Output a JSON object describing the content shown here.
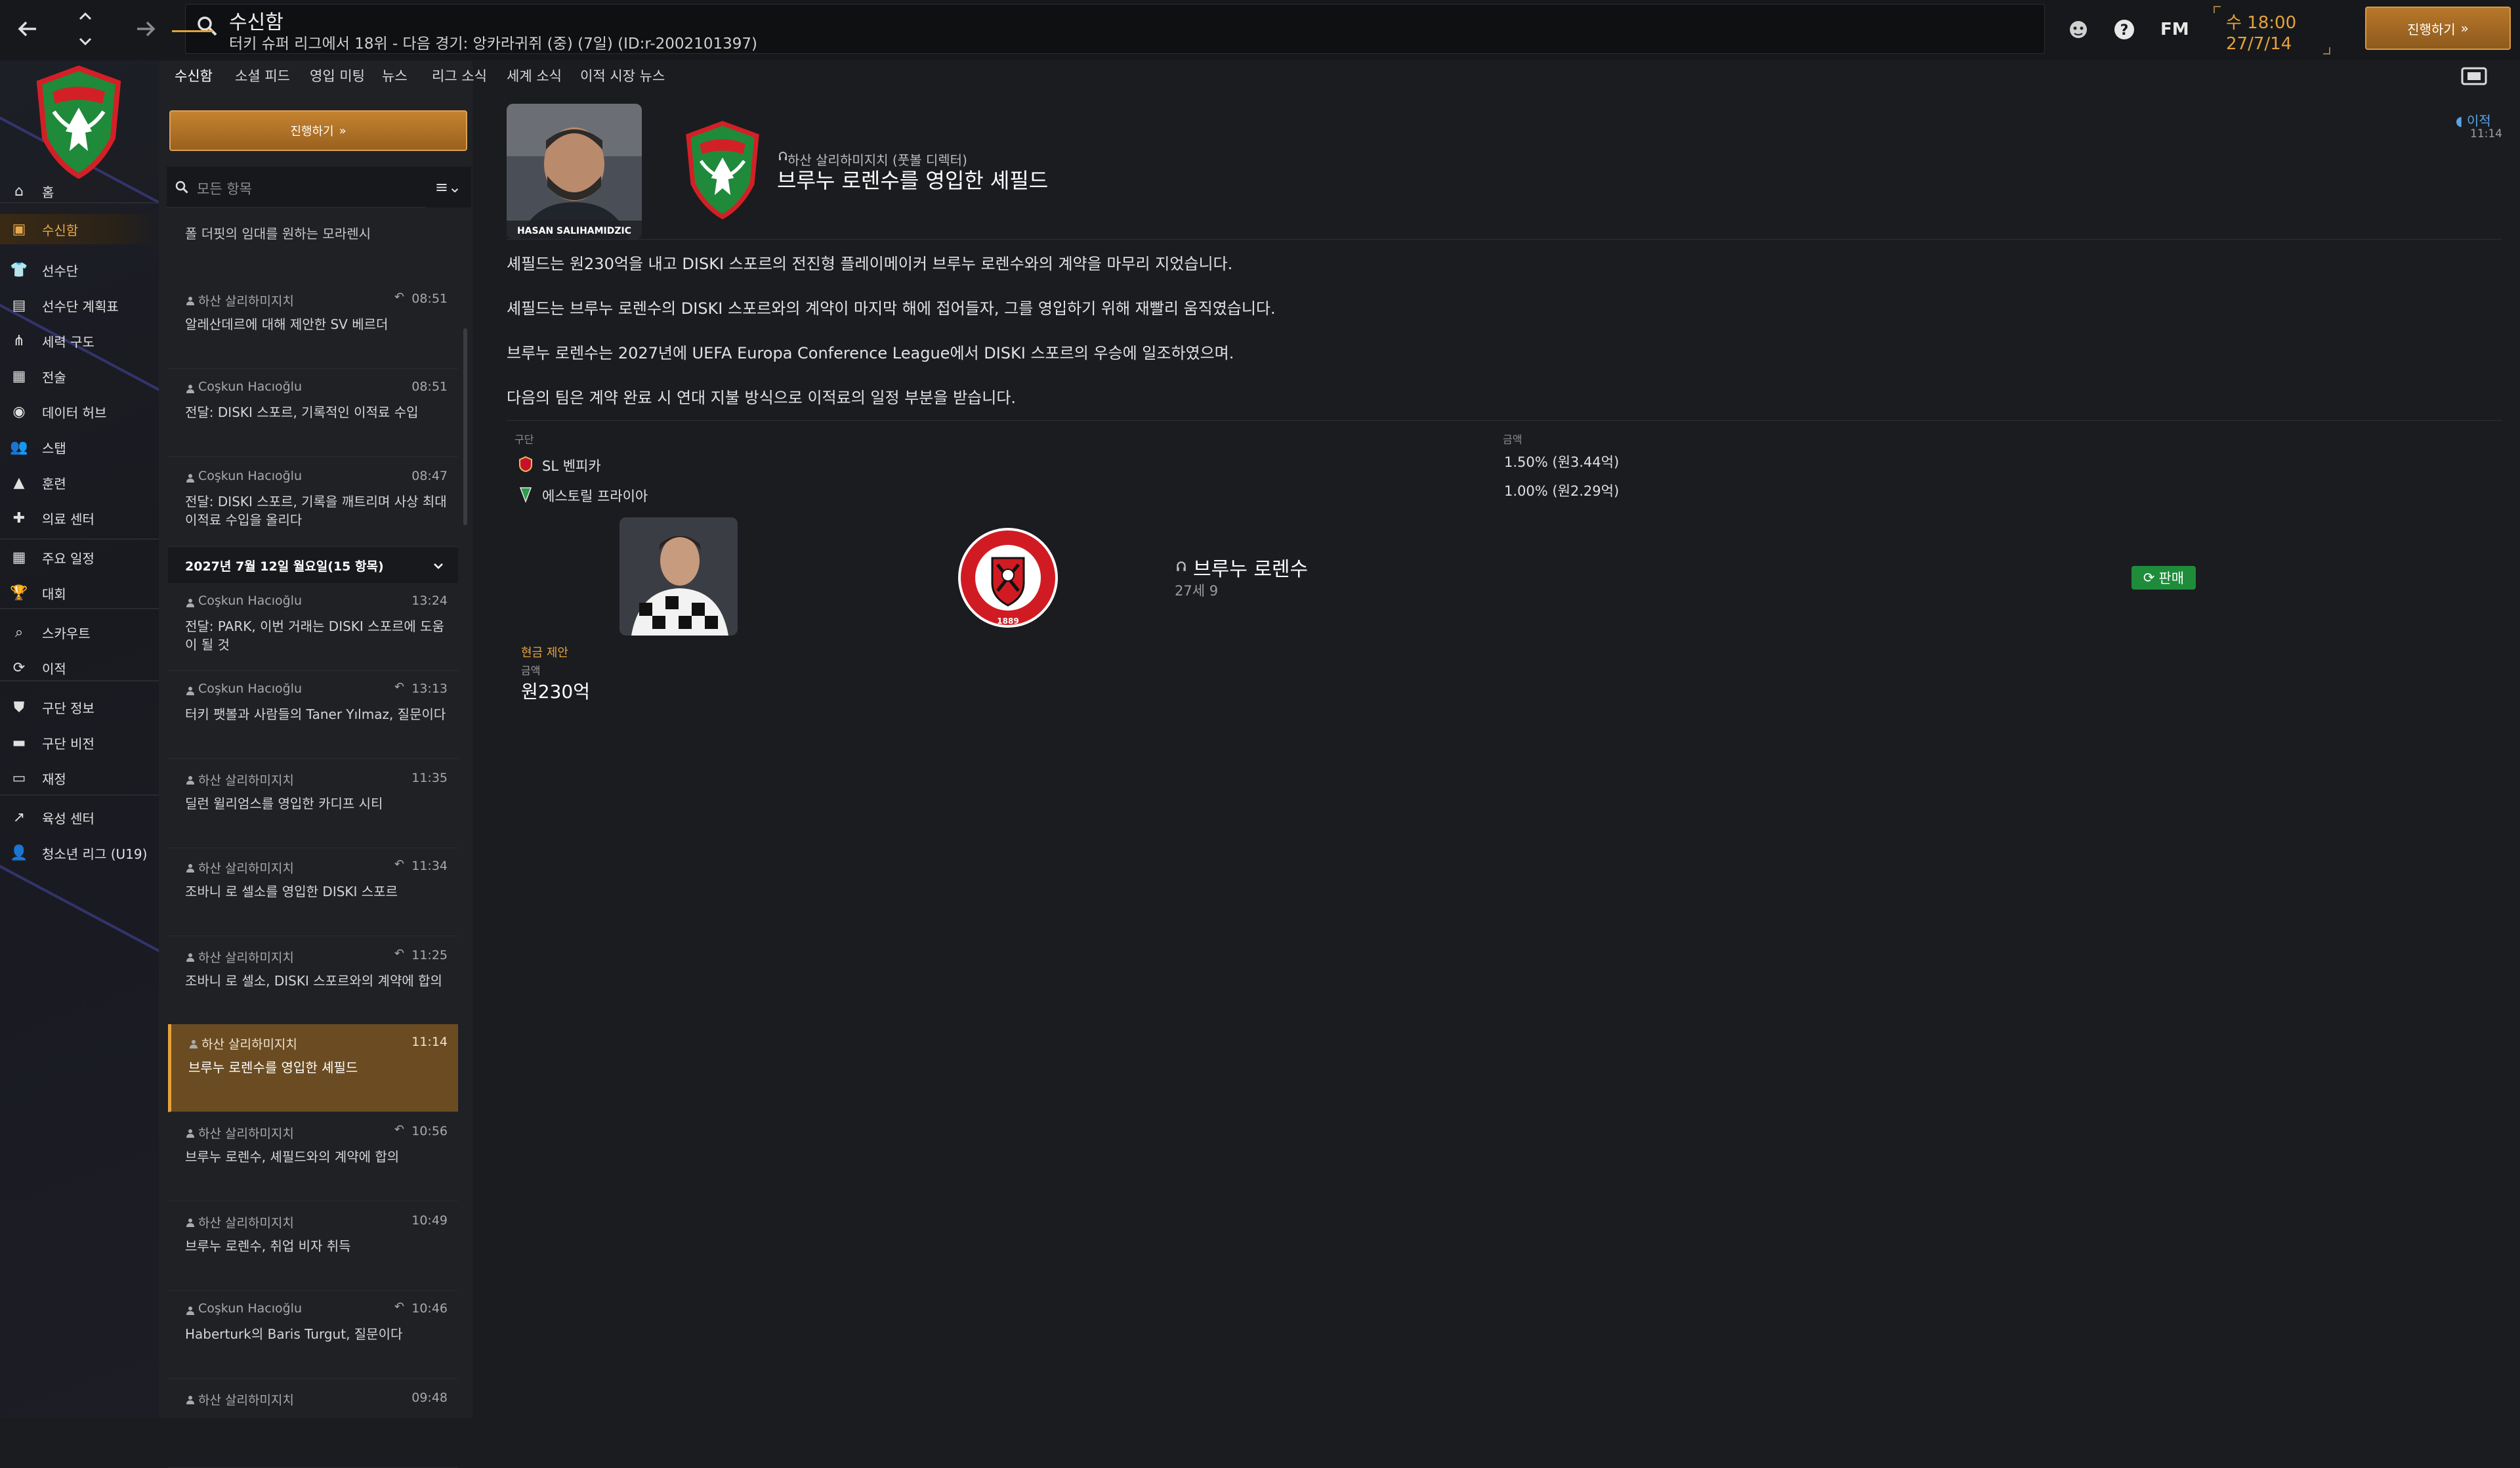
{
  "topbar": {
    "title": "수신함",
    "subtitle": "터키 슈퍼 리그에서 18위 - 다음 경기: 앙카라귀쥐 (중) (7일) (ID:r-2002101397)",
    "fm_logo": "FM",
    "time": "수 18:00",
    "date": "27/7/14",
    "continue_label": "진행하기",
    "icons": [
      "back-arrow-icon",
      "up-down-icon",
      "forward-arrow-icon",
      "search-icon",
      "manager-face-icon",
      "help-icon"
    ]
  },
  "sidebar": {
    "items": [
      {
        "label": "홈",
        "icon": "home-icon"
      },
      {
        "label": "수신함",
        "icon": "inbox-icon",
        "active": true
      },
      {
        "label": "선수단",
        "icon": "shirt-icon"
      },
      {
        "label": "선수단 계획표",
        "icon": "clipboard-icon"
      },
      {
        "label": "세력 구도",
        "icon": "network-icon"
      },
      {
        "label": "전술",
        "icon": "tactics-icon"
      },
      {
        "label": "데이터 허브",
        "icon": "data-hub-icon"
      },
      {
        "label": "스탭",
        "icon": "staff-icon"
      },
      {
        "label": "훈련",
        "icon": "cone-icon"
      },
      {
        "label": "의료 센터",
        "icon": "medical-icon"
      },
      {
        "label": "주요 일정",
        "icon": "calendar-icon"
      },
      {
        "label": "대회",
        "icon": "trophy-icon"
      },
      {
        "label": "스카우트",
        "icon": "scout-icon"
      },
      {
        "label": "이적",
        "icon": "transfer-icon"
      },
      {
        "label": "구단 정보",
        "icon": "shield-icon"
      },
      {
        "label": "구단 비전",
        "icon": "vision-icon"
      },
      {
        "label": "재정",
        "icon": "finance-icon"
      },
      {
        "label": "육성 센터",
        "icon": "development-icon"
      },
      {
        "label": "청소년 리그 (U19)",
        "icon": "youth-icon"
      }
    ]
  },
  "tabs": [
    "수신함",
    "소셜 피드",
    "영입 미팅",
    "뉴스",
    "리그 소식",
    "세계 소식",
    "이적 시장 뉴스"
  ],
  "list": {
    "continue_label": "진행하기",
    "filter_placeholder": "모든 항목",
    "top_snippet": "폴 더핏의 임대를 원하는 모라렌시",
    "date_header": "2027년 7월 12일 월요일(15 항목)",
    "messages": [
      {
        "sender": "하산 살리하미지치",
        "time": "08:51",
        "subject": "알레산데르에 대해 제안한 SV 베르더",
        "replied": true
      },
      {
        "sender": "Coşkun Hacıoğlu",
        "time": "08:51",
        "subject": "전달: DISKI 스포르, 기록적인 이적료 수입",
        "replied": false
      },
      {
        "sender": "Coşkun Hacıoğlu",
        "time": "08:47",
        "subject": "전달: DISKI 스포르, 기록을 깨트리며 사상 최대 이적료 수입을 올리다",
        "replied": false
      },
      {
        "sender": "Coşkun Hacıoğlu",
        "time": "13:24",
        "subject": "전달: PARK, 이번 거래는 DISKI 스포르에 도움이 될 것",
        "replied": false
      },
      {
        "sender": "Coşkun Hacıoğlu",
        "time": "13:13",
        "subject": "터키 팻볼과 사람들의 Taner Yılmaz, 질문이다",
        "replied": true
      },
      {
        "sender": "하산 살리하미지치",
        "time": "11:35",
        "subject": "딜런 윌리엄스를 영입한 카디프 시티",
        "replied": false
      },
      {
        "sender": "하산 살리하미지치",
        "time": "11:34",
        "subject": "조바니 로 셀소를 영입한 DISKI 스포르",
        "replied": true
      },
      {
        "sender": "하산 살리하미지치",
        "time": "11:25",
        "subject": "조바니 로 셀소, DISKI 스포르와의 계약에 합의",
        "replied": true
      },
      {
        "sender": "하산 살리하미지치",
        "time": "11:14",
        "subject": "브루누 로렌수를 영입한 셰필드",
        "replied": false,
        "selected": true
      },
      {
        "sender": "하산 살리하미지치",
        "time": "10:56",
        "subject": "브루누 로렌수, 셰필드와의 계약에 합의",
        "replied": true
      },
      {
        "sender": "하산 살리하미지치",
        "time": "10:49",
        "subject": "브루누 로렌수, 취업 비자 취득",
        "replied": false
      },
      {
        "sender": "Coşkun Hacıoğlu",
        "time": "10:46",
        "subject": "Haberturk의 Baris Turgut, 질문이다",
        "replied": true
      },
      {
        "sender": "하산 살리하미지치",
        "time": "09:48",
        "subject": "",
        "replied": false
      }
    ]
  },
  "detail": {
    "photo_caption": "HASAN SALIHAMIDZIC",
    "from": "하산 살리하미지치 (풋볼 디렉터)",
    "headline": "브루누 로렌수를 영입한 셰필드",
    "category": "이적",
    "category_time": "11:14",
    "paragraphs": [
      "셰필드는 원230억을 내고 DISKI 스포르의 전진형 플레이메이커 브루누 로렌수와의 계약을 마무리 지었습니다.",
      "셰필드는 브루누 로렌수의 DISKI 스포르와의 계약이 마지막 해에 접어들자, 그를 영입하기 위해 재빨리 움직였습니다.",
      "브루누 로렌수는 2027년에 UEFA Europa Conference League에서 DISKI 스포르의 우승에 일조하였으며.",
      "다음의 팀은 계약 완료 시 연대 지불 방식으로 이적료의 일정 부분을 받습니다."
    ],
    "table": {
      "col_club": "구단",
      "col_amount": "금액",
      "rows": [
        {
          "club": "SL 벤피카",
          "amount": "1.50% (원3.44억)",
          "color": "#c8102e"
        },
        {
          "club": "에스토릴 프라이아",
          "amount": "1.00% (원2.29억)",
          "color": "#2a9d4a"
        }
      ]
    },
    "player_name": "브루누 로렌수",
    "player_age": "27세 9",
    "sale_label": "판매",
    "fee_type": "현금 제안",
    "fee_label": "금액",
    "fee_value": "원230억"
  }
}
